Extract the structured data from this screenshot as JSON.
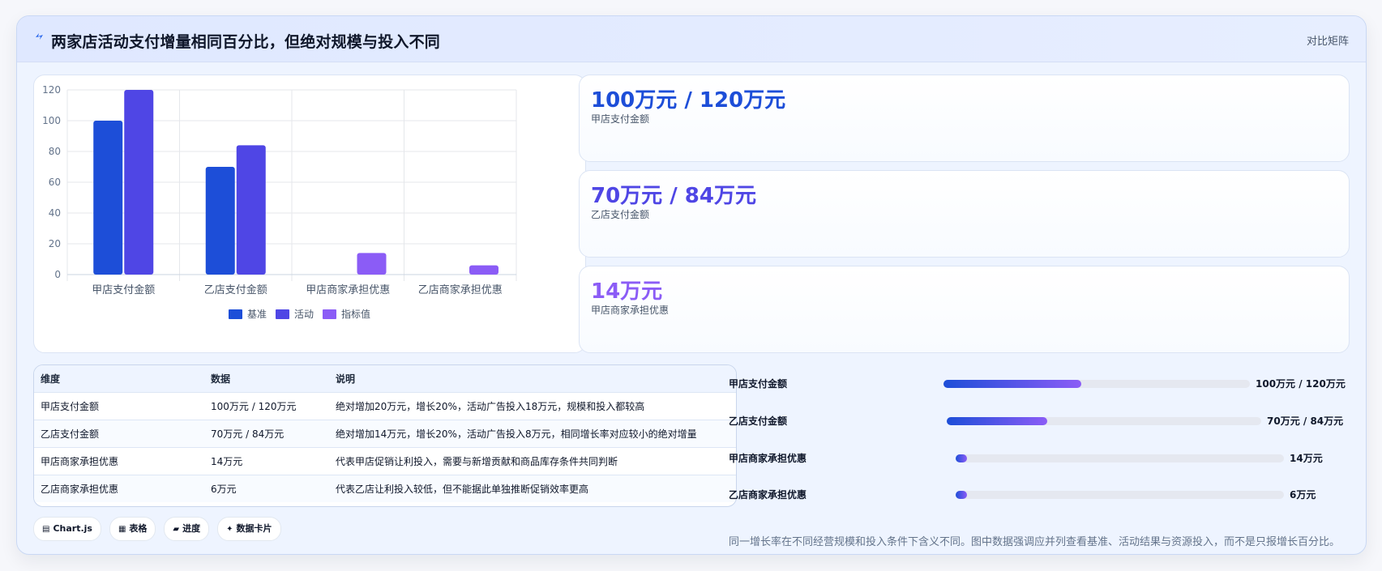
{
  "header": {
    "title": "两家店活动支付增量相同百分比，但绝对规模与投入不同",
    "badge": "对比矩阵",
    "icon": "spark-icon"
  },
  "colors": {
    "primary": "#1d4ed8",
    "accent": "#4f46e5",
    "violet": "#8b5cf6",
    "gridline": "#e5e7eb"
  },
  "chart_data": {
    "type": "bar",
    "categories": [
      "甲店支付金额",
      "乙店支付金额",
      "甲店商家承担优惠",
      "乙店商家承担优惠"
    ],
    "series": [
      {
        "name": "基准",
        "values": [
          100,
          70,
          null,
          null
        ],
        "color": "#1d4ed8"
      },
      {
        "name": "活动",
        "values": [
          120,
          84,
          null,
          null
        ],
        "color": "#4f46e5"
      },
      {
        "name": "指标值",
        "values": [
          null,
          null,
          14,
          6
        ],
        "color": "#8b5cf6"
      }
    ],
    "yticks": [
      "0",
      "20",
      "40",
      "60",
      "80",
      "100",
      "120"
    ],
    "ylim": [
      0,
      120
    ],
    "grid": true,
    "legend": "bottom"
  },
  "metrics": [
    {
      "value": "100万元 / 120万元",
      "label": "甲店支付金额",
      "color": "#1d4ed8"
    },
    {
      "value": "70万元 / 84万元",
      "label": "乙店支付金额",
      "color": "#4f46e5"
    },
    {
      "value": "14万元",
      "label": "甲店商家承担优惠",
      "color": "#8b5cf6"
    }
  ],
  "table": {
    "headers": [
      "维度",
      "数据",
      "说明"
    ],
    "rows": [
      [
        "甲店支付金额",
        "100万元 / 120万元",
        "绝对增加20万元，增长20%，活动广告投入18万元，规模和投入都较高"
      ],
      [
        "乙店支付金额",
        "70万元 / 84万元",
        "绝对增加14万元，增长20%，活动广告投入8万元，相同增长率对应较小的绝对增量"
      ],
      [
        "甲店商家承担优惠",
        "14万元",
        "代表甲店促销让利投入，需要与新增贡献和商品库存条件共同判断"
      ],
      [
        "乙店商家承担优惠",
        "6万元",
        "代表乙店让利投入较低，但不能据此单独推断促销效率更高"
      ]
    ]
  },
  "chips": [
    {
      "icon": "chart-icon",
      "glyph": "▤",
      "label": "Chart.js"
    },
    {
      "icon": "table-icon",
      "glyph": "▦",
      "label": "表格"
    },
    {
      "icon": "progress-icon",
      "glyph": "▰",
      "label": "进度"
    },
    {
      "icon": "data-card-icon",
      "glyph": "✦",
      "label": "数据卡片"
    }
  ],
  "progress": [
    {
      "label": "甲店支付金额",
      "value_text": "100万元 / 120万元",
      "fraction": 0.45
    },
    {
      "label": "乙店支付金额",
      "value_text": "70万元 / 84万元",
      "fraction": 0.32
    },
    {
      "label": "甲店商家承担优惠",
      "value_text": "14万元",
      "fraction": 0.035
    },
    {
      "label": "乙店商家承担优惠",
      "value_text": "6万元",
      "fraction": 0.035
    }
  ],
  "note": "同一增长率在不同经营规模和投入条件下含义不同。图中数据强调应并列查看基准、活动结果与资源投入，而不是只报增长百分比。"
}
